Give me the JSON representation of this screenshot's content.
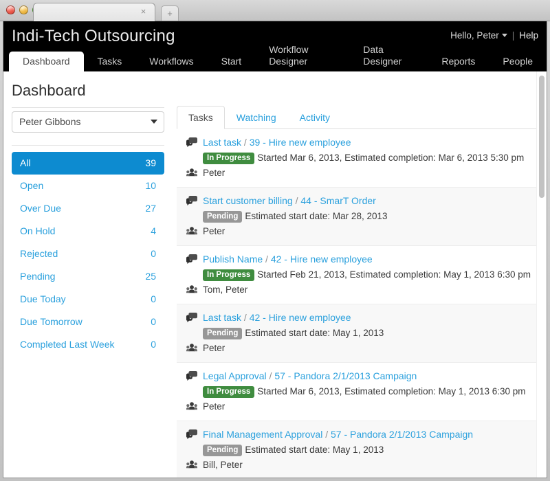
{
  "browser": {
    "tab_close_glyph": "×",
    "new_tab_glyph": "+",
    "tab_title": ""
  },
  "header": {
    "brand": "Indi-Tech Outsourcing",
    "greeting": "Hello, Peter",
    "separator": "|",
    "help_label": "Help"
  },
  "nav": {
    "items": [
      {
        "label": "Dashboard",
        "active": true
      },
      {
        "label": "Tasks",
        "active": false
      },
      {
        "label": "Workflows",
        "active": false
      },
      {
        "label": "Start",
        "active": false
      },
      {
        "label": "Workflow Designer",
        "active": false
      },
      {
        "label": "Data Designer",
        "active": false
      },
      {
        "label": "Reports",
        "active": false
      },
      {
        "label": "People",
        "active": false
      }
    ]
  },
  "page": {
    "title": "Dashboard"
  },
  "sidebar": {
    "user_select": {
      "value": "Peter Gibbons",
      "options": [
        "Peter Gibbons"
      ]
    },
    "filters": [
      {
        "label": "All",
        "count": "39",
        "active": true
      },
      {
        "label": "Open",
        "count": "10",
        "active": false
      },
      {
        "label": "Over Due",
        "count": "27",
        "active": false
      },
      {
        "label": "On Hold",
        "count": "4",
        "active": false
      },
      {
        "label": "Rejected",
        "count": "0",
        "active": false
      },
      {
        "label": "Pending",
        "count": "25",
        "active": false
      },
      {
        "label": "Due Today",
        "count": "0",
        "active": false
      },
      {
        "label": "Due Tomorrow",
        "count": "0",
        "active": false
      },
      {
        "label": "Completed Last Week",
        "count": "0",
        "active": false
      }
    ]
  },
  "content": {
    "tabs": [
      {
        "label": "Tasks",
        "active": true
      },
      {
        "label": "Watching",
        "active": false
      },
      {
        "label": "Activity",
        "active": false
      }
    ],
    "tasks": [
      {
        "task_name": "Last task",
        "separator": "/",
        "workflow": "39 - Hire new employee",
        "status": "In Progress",
        "status_color": "#3f8c3f",
        "meta": "Started Mar 6, 2013, Estimated completion: Mar 6, 2013 5:30 pm",
        "people": "Peter"
      },
      {
        "task_name": "Start customer billing",
        "separator": "/",
        "workflow": "44 - SmarT Order",
        "status": "Pending",
        "status_color": "#979797",
        "meta": "Estimated start date: Mar 28, 2013",
        "people": "Peter"
      },
      {
        "task_name": "Publish Name",
        "separator": "/",
        "workflow": "42 - Hire new employee",
        "status": "In Progress",
        "status_color": "#3f8c3f",
        "meta": "Started Feb 21, 2013, Estimated completion: May 1, 2013 6:30 pm",
        "people": "Tom, Peter"
      },
      {
        "task_name": "Last task",
        "separator": "/",
        "workflow": "42 - Hire new employee",
        "status": "Pending",
        "status_color": "#979797",
        "meta": "Estimated start date: May 1, 2013",
        "people": "Peter"
      },
      {
        "task_name": "Legal Approval",
        "separator": "/",
        "workflow": "57 - Pandora 2/1/2013 Campaign",
        "status": "In Progress",
        "status_color": "#3f8c3f",
        "meta": "Started Mar 6, 2013, Estimated completion: May 1, 2013 6:30 pm",
        "people": "Peter"
      },
      {
        "task_name": "Final Management Approval",
        "separator": "/",
        "workflow": "57 - Pandora 2/1/2013 Campaign",
        "status": "Pending",
        "status_color": "#979797",
        "meta": "Estimated start date: May 1, 2013",
        "people": "Bill, Peter"
      }
    ]
  },
  "colors": {
    "accent_blue": "#0d8bd0",
    "link_blue": "#2aa0dd",
    "header_black": "#000000",
    "badge_green": "#3f8c3f",
    "badge_gray": "#979797",
    "row_alt": "#f8f8f8"
  }
}
